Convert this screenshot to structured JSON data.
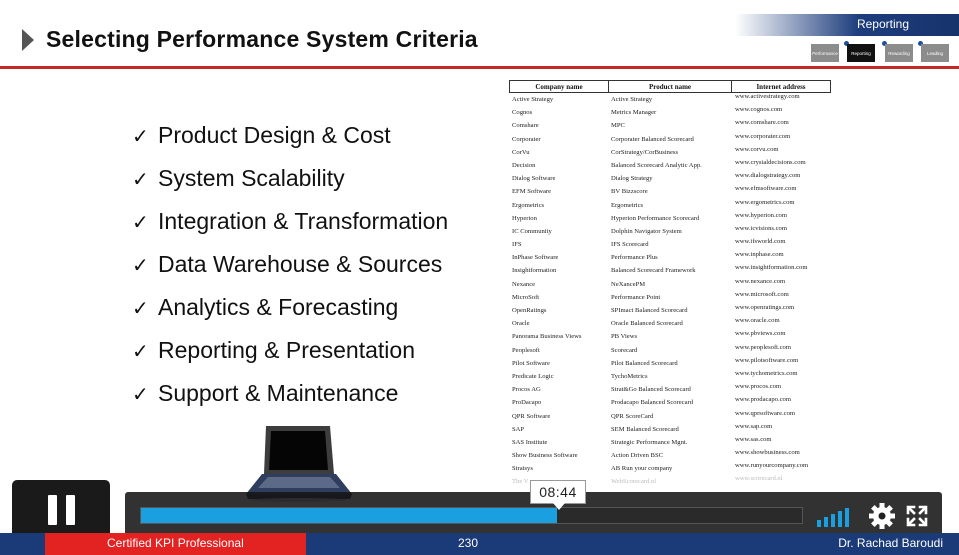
{
  "slide": {
    "title": "Selecting Performance System Criteria",
    "section": "Reporting",
    "stepper": [
      "Performance",
      "Reporting",
      "Rewarding",
      "Leading"
    ],
    "stepper_active": 1,
    "criteria": [
      "Product Design & Cost",
      "System Scalability",
      "Integration & Transformation",
      "Data Warehouse & Sources",
      "Analytics & Forecasting",
      "Reporting & Presentation",
      "Support & Maintenance"
    ],
    "check_glyph": "✓"
  },
  "vendor_table": {
    "headers": [
      "Company name",
      "Product name",
      "Internet address"
    ],
    "rows": [
      [
        "Active Strategy",
        "Active Strategy",
        "www.activestrategy.com"
      ],
      [
        "Cognos",
        "Metrics Manager",
        "www.cognos.com"
      ],
      [
        "Comshare",
        "MPC",
        "www.comshare.com"
      ],
      [
        "Corporater",
        "Corporater Balanced Scorecard",
        "www.corporater.com"
      ],
      [
        "CorVu",
        "CorStrategy/CorBusiness",
        "www.corvu.com"
      ],
      [
        "Decision",
        "Balanced Scorecard Analytic App.",
        "www.crystaldecisions.com"
      ],
      [
        "Dialog Software",
        "Dialog Strategy",
        "www.dialogstrategy.com"
      ],
      [
        "EFM Software",
        "BV Bizzscore",
        "www.efmsoftware.com"
      ],
      [
        "Ergometrics",
        "Ergometrics",
        "www.ergometrics.com"
      ],
      [
        "Hyperion",
        "Hyperion Performance Scorecard",
        "www.hyperion.com"
      ],
      [
        "IC Community",
        "Dolphin Navigator System",
        "www.icvisions.com"
      ],
      [
        "IFS",
        "IFS Scorecard",
        "www.ifsworld.com"
      ],
      [
        "InPhase Software",
        "Performance Plus",
        "www.inphase.com"
      ],
      [
        "Insightformation",
        "Balanced Scorecard Framework",
        "www.insightformation.com"
      ],
      [
        "Nexance",
        "NeXancePM",
        "www.nexance.com"
      ],
      [
        "MicroSoft",
        "Performance Point",
        "www.microsoft.com"
      ],
      [
        "OpenRatings",
        "SPImact Balanced Scorecard",
        "www.openratings.com"
      ],
      [
        "Oracle",
        "Oracle Balanced Scorecard",
        "www.oracle.com"
      ],
      [
        "Panorama Business Views",
        "PB Views",
        "www.pbviews.com"
      ],
      [
        "Peoplesoft",
        "Scorecard",
        "www.peoplesoft.com"
      ],
      [
        "Pilot Software",
        "Pilot Balanced Scorecard",
        "www.pilotsoftware.com"
      ],
      [
        "Predicate Logic",
        "TychoMetrics",
        "www.tychometrics.com"
      ],
      [
        "Procos AG",
        "Strat&Go Balanced Scorecard",
        "www.procos.com"
      ],
      [
        "ProDacapo",
        "Prodacapo Balanced Scorecard",
        "www.prodacapo.com"
      ],
      [
        "QPR Software",
        "QPR ScoreCard",
        "www.qprsoftware.com"
      ],
      [
        "SAP",
        "SEM Balanced Scorecard",
        "www.sap.com"
      ],
      [
        "SAS Institute",
        "Strategic Performance Mgnt.",
        "www.sas.com"
      ],
      [
        "Show Business Software",
        "Action Driven BSC",
        "www.showbusiness.com"
      ],
      [
        "Stratsys",
        "AB Run your company",
        "www.runyourcompany.com"
      ],
      [
        "The V",
        "WebScorecard.nl",
        "www.scorecard.nl"
      ]
    ]
  },
  "player": {
    "time_tooltip": "08:44",
    "progress_fraction": 0.63,
    "icons": [
      "pause-icon",
      "volume-icon",
      "settings-gear-icon",
      "fullscreen-icon"
    ]
  },
  "footer": {
    "course": "Certified KPI Professional",
    "page": "230",
    "author": "Dr. Rachad Baroudi"
  },
  "colors": {
    "accent_red": "#e32222",
    "footer_blue": "#1b3a78",
    "progress_blue": "#1aa0e0",
    "header_rule": "#c62828"
  }
}
